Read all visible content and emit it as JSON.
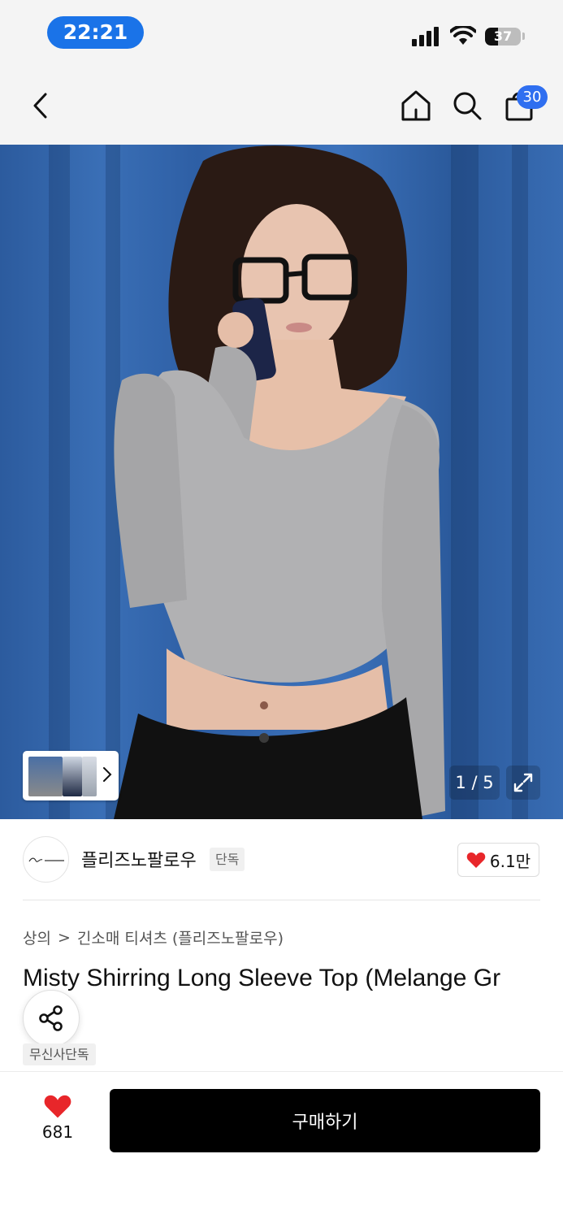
{
  "status_bar": {
    "time": "22:21",
    "battery": "37",
    "battery_level": 0.37
  },
  "nav": {
    "cart_count": "30"
  },
  "gallery": {
    "counter": "1 / 5"
  },
  "brand": {
    "name": "플리즈노팔로우",
    "tag": "단독",
    "likes": "6.1만"
  },
  "breadcrumb": {
    "category": "상의",
    "separator": ">",
    "subcategory": "긴소매 티셔츠 (플리즈노팔로우)"
  },
  "product": {
    "title": "Misty Shirring Long Sleeve Top (Melange Gr",
    "tag": "무신사단독"
  },
  "bottom_bar": {
    "like_count": "681",
    "buy_label": "구매하기"
  },
  "colors": {
    "accent_blue": "#2f6ff0",
    "time_pill": "#1a73e8",
    "heart_red": "#e8262a",
    "buy_button": "#000000"
  },
  "icons": [
    "back-icon",
    "home-icon",
    "search-icon",
    "shopping-bag-icon",
    "chevron-right-icon",
    "expand-icon",
    "heart-icon",
    "share-icon"
  ]
}
